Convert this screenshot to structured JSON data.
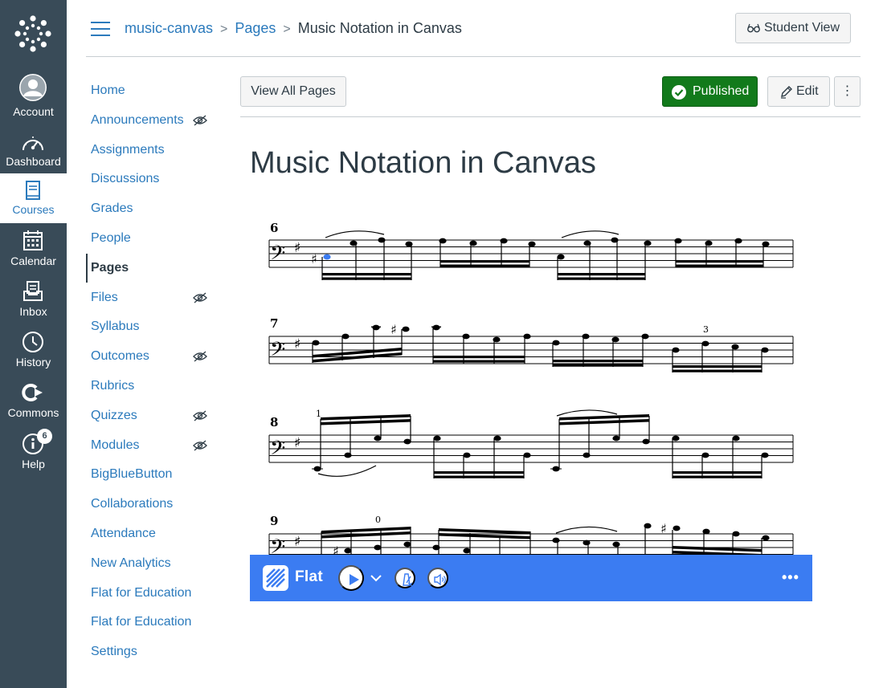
{
  "global_nav": {
    "items": [
      {
        "label": "Account",
        "icon": "account-avatar-icon"
      },
      {
        "label": "Dashboard",
        "icon": "dashboard-gauge-icon"
      },
      {
        "label": "Courses",
        "icon": "courses-book-icon"
      },
      {
        "label": "Calendar",
        "icon": "calendar-icon"
      },
      {
        "label": "Inbox",
        "icon": "inbox-icon"
      },
      {
        "label": "History",
        "icon": "history-clock-icon"
      },
      {
        "label": "Commons",
        "icon": "commons-icon"
      },
      {
        "label": "Help",
        "icon": "help-icon"
      }
    ],
    "active": "Courses",
    "help_badge": "6",
    "background": "#394b58",
    "active_color": "#2b7abc"
  },
  "breadcrumb": {
    "course": "music-canvas",
    "section": "Pages",
    "current": "Music Notation in Canvas",
    "separator": ">"
  },
  "header": {
    "student_view_label": "Student View"
  },
  "course_nav": {
    "items": [
      {
        "label": "Home",
        "hidden": false
      },
      {
        "label": "Announcements",
        "hidden": true
      },
      {
        "label": "Assignments",
        "hidden": false
      },
      {
        "label": "Discussions",
        "hidden": false
      },
      {
        "label": "Grades",
        "hidden": false
      },
      {
        "label": "People",
        "hidden": false
      },
      {
        "label": "Pages",
        "hidden": false,
        "active": true
      },
      {
        "label": "Files",
        "hidden": true
      },
      {
        "label": "Syllabus",
        "hidden": false
      },
      {
        "label": "Outcomes",
        "hidden": true
      },
      {
        "label": "Rubrics",
        "hidden": false
      },
      {
        "label": "Quizzes",
        "hidden": true
      },
      {
        "label": "Modules",
        "hidden": true
      },
      {
        "label": "BigBlueButton",
        "hidden": false
      },
      {
        "label": "Collaborations",
        "hidden": false
      },
      {
        "label": "Attendance",
        "hidden": false
      },
      {
        "label": "New Analytics",
        "hidden": false
      },
      {
        "label": "Flat for Education",
        "hidden": false
      },
      {
        "label": "Flat for Education",
        "hidden": false
      },
      {
        "label": "Settings",
        "hidden": false
      }
    ]
  },
  "page_actions": {
    "view_all_label": "View All Pages",
    "published_label": "Published",
    "edit_label": "Edit",
    "more_label": "⋮",
    "published_color": "#127a1b"
  },
  "page": {
    "title": "Music Notation in Canvas"
  },
  "score": {
    "clef": "bass",
    "key_signature": "1 sharp",
    "measures": [
      {
        "number": "6",
        "annotations": []
      },
      {
        "number": "7",
        "annotations": [
          "3"
        ]
      },
      {
        "number": "8",
        "annotations": [
          "1"
        ]
      },
      {
        "number": "9",
        "annotations": [
          "0"
        ]
      }
    ]
  },
  "flat_player": {
    "brand": "Flat",
    "play_label": "Play",
    "more_label": "•••",
    "bar_color": "#3b7cf2"
  }
}
